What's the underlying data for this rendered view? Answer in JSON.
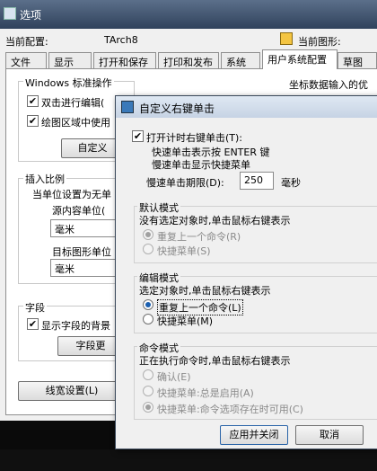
{
  "options": {
    "title": "选项",
    "current_profile_label": "当前配置:",
    "current_profile_value": "TArch8",
    "current_drawing_label": "当前图形:",
    "tabs": [
      "文件",
      "显示",
      "打开和保存",
      "打印和发布",
      "系统",
      "用户系统配置",
      "草图"
    ],
    "active_tab_index": 5,
    "windows_group": "Windows 标准操作",
    "dblclick_edit": "双击进行编辑(",
    "shortcut_menu": "绘图区域中使用",
    "custom_right_btn": "自定义",
    "coord_group": "坐标数据输入的优",
    "insert_scale_group": "插入比例",
    "unit_label": "当单位设置为无单",
    "source_units_label": "源内容单位(",
    "source_units_value": "毫米",
    "target_units_label": "目标图形单位",
    "target_units_value": "毫米",
    "fields_group": "字段",
    "show_field_bg": "显示字段的背景",
    "field_update_btn": "字段更",
    "lineweight_btn": "线宽设置(L)"
  },
  "rc": {
    "title": "自定义右键单击",
    "timed_on": "打开计时右键单击(T):",
    "quick_desc": "快速单击表示按 ENTER 键",
    "slow_desc": "慢速单击显示快捷菜单",
    "slow_period_label": "慢速单击期限(D):",
    "slow_period_value": "250",
    "ms": "毫秒",
    "default_group": "默认模式",
    "default_desc": "没有选定对象时,单击鼠标右键表示",
    "default_opt1": "重复上一个命令(R)",
    "default_opt2": "快捷菜单(S)",
    "edit_group": "编辑模式",
    "edit_desc": "选定对象时,单击鼠标右键表示",
    "edit_opt1": "重复上一个命令(L)",
    "edit_opt2": "快捷菜单(M)",
    "cmd_group": "命令模式",
    "cmd_desc": "正在执行命令时,单击鼠标右键表示",
    "cmd_opt1": "确认(E)",
    "cmd_opt2": "快捷菜单:总是启用(A)",
    "cmd_opt3": "快捷菜单:命令选项存在时可用(C)",
    "apply_btn": "应用并关闭",
    "cancel_btn": "取消"
  }
}
